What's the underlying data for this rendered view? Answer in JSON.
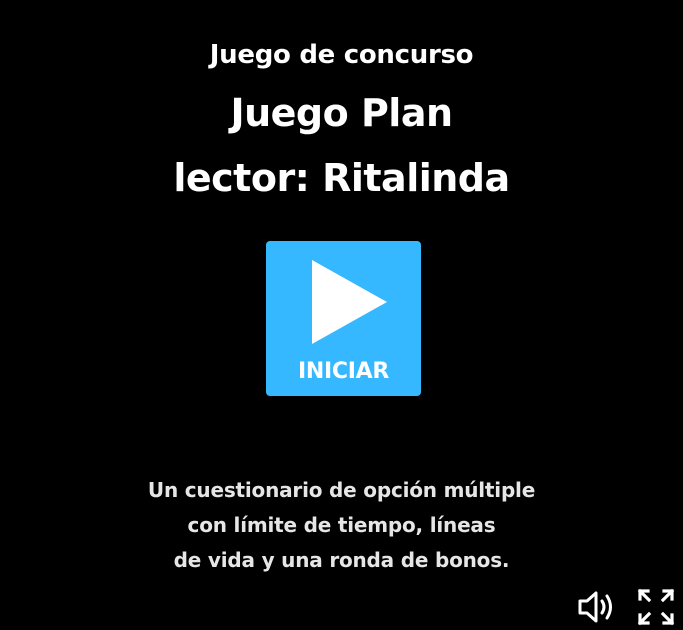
{
  "header": {
    "subtitle": "Juego de concurso",
    "title_line1": "Juego Plan",
    "title_line2": "lector: Ritalinda"
  },
  "start": {
    "label": "INICIAR",
    "icon": "play-icon"
  },
  "description": {
    "line1": "Un cuestionario de opción múltiple",
    "line2": "con límite de tiempo, líneas",
    "line3": "de vida y una ronda de bonos."
  },
  "controls": {
    "sound_icon": "speaker-icon",
    "fullscreen_icon": "fullscreen-icon"
  },
  "colors": {
    "background": "#000000",
    "accent": "#35b8ff",
    "text": "#ffffff"
  }
}
